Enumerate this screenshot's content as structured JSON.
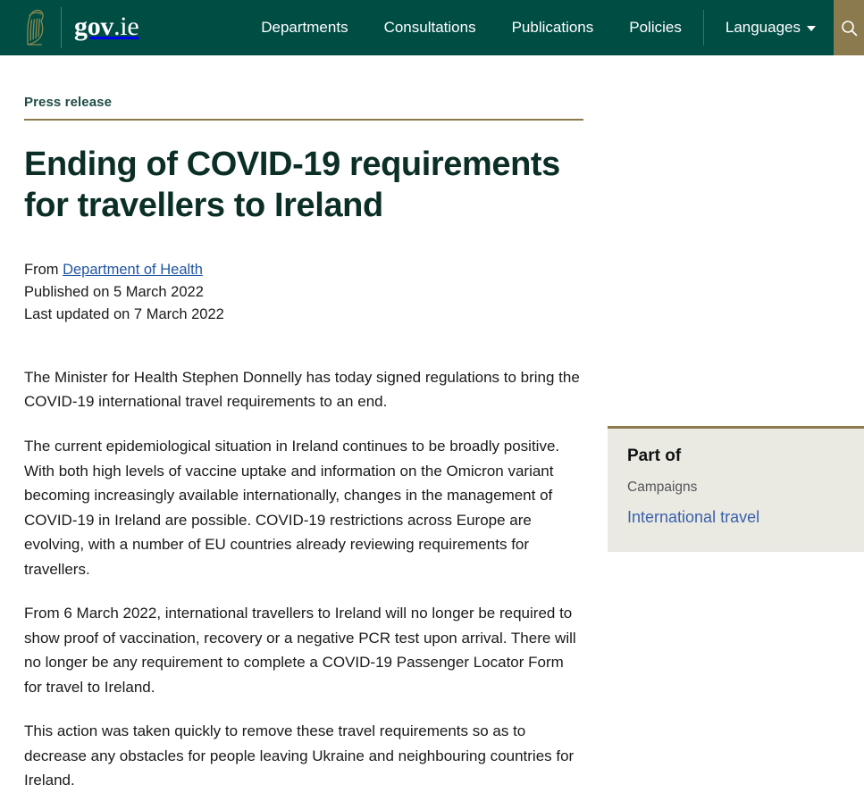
{
  "header": {
    "logo_icon": "irish-harp-icon",
    "wordmark_main": "gov",
    "wordmark_suffix": ".ie",
    "nav_items": [
      {
        "label": "Departments"
      },
      {
        "label": "Consultations"
      },
      {
        "label": "Publications"
      },
      {
        "label": "Policies"
      },
      {
        "label": "Languages"
      }
    ],
    "search_icon": "search-icon",
    "colors": {
      "header_bg": "#004d44",
      "search_bg": "#8a7a4d",
      "accent_gold": "#8a7a4d",
      "link_blue": "#2255a4"
    }
  },
  "article": {
    "eyebrow": "Press release",
    "title": "Ending of COVID-19 requirements for travellers to Ireland",
    "from_prefix": "From",
    "from_org": "Department of Health",
    "published": "Published on 5 March 2022",
    "last_updated": "Last updated on 7 March 2022",
    "paragraphs": [
      "The Minister for Health Stephen Donnelly has today signed regulations to bring the COVID-19 international travel requirements to an end.",
      "The current epidemiological situation in Ireland continues to be broadly positive. With both high levels of vaccine uptake and information on the Omicron variant becoming increasingly available internationally, changes in the management of COVID-19 in Ireland are possible. COVID-19 restrictions across Europe are evolving, with a number of EU countries already reviewing requirements for travellers.",
      "From 6 March 2022, international travellers to Ireland will no longer be required to show proof of vaccination, recovery or a negative PCR test upon arrival. There will no longer be any requirement to complete a COVID-19 Passenger Locator Form for travel to Ireland.",
      "This action was taken quickly to remove these travel requirements so as to decrease any obstacles for people leaving Ukraine and neighbouring countries for Ireland."
    ]
  },
  "sidebar": {
    "heading": "Part of",
    "category": "Campaigns",
    "link": "International travel"
  }
}
